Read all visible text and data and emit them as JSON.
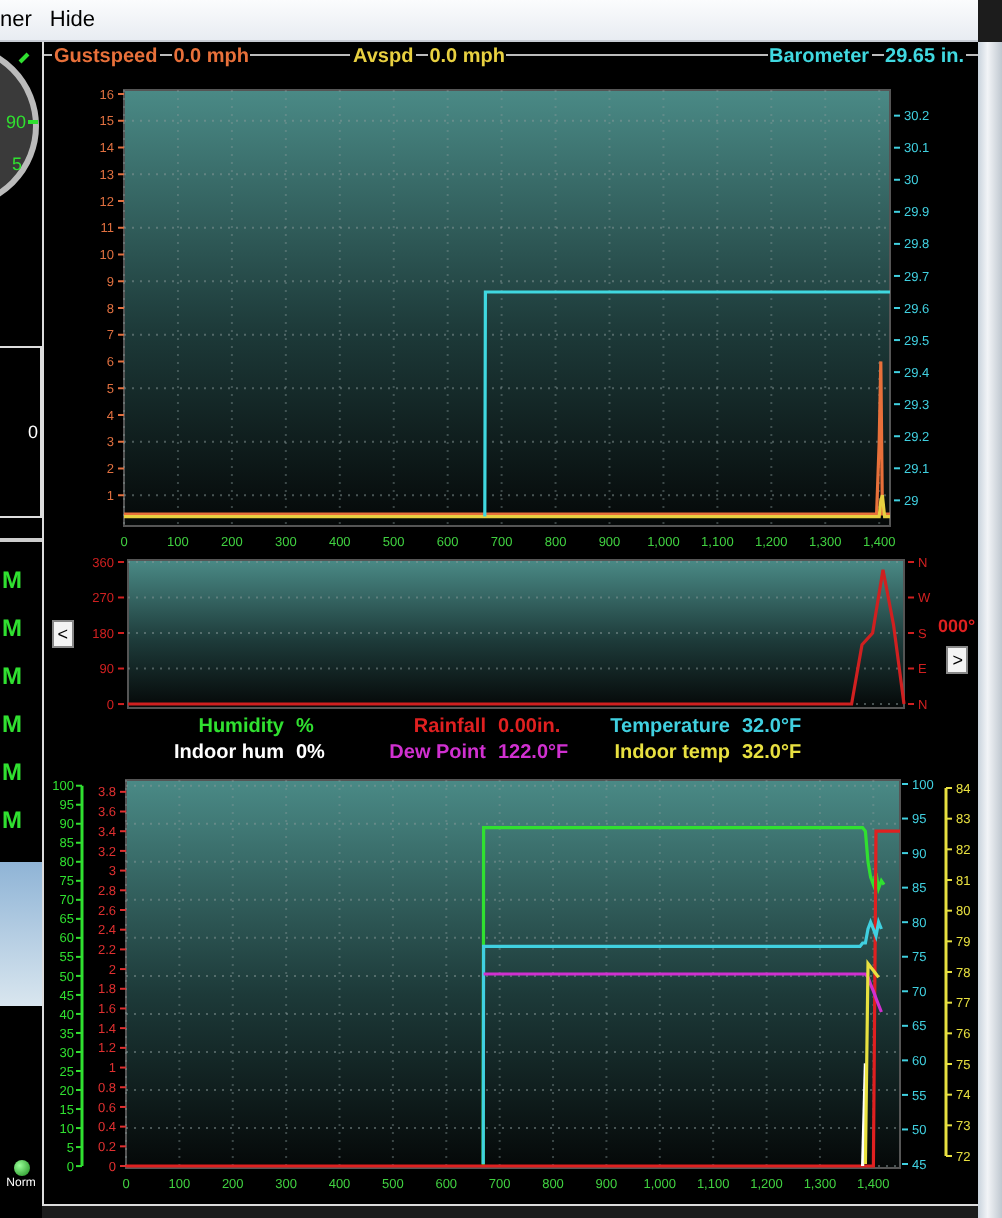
{
  "menu": [
    {
      "label": "ner"
    },
    {
      "label": "Hide"
    }
  ],
  "side_panel": {
    "gauge_labels": [
      "90",
      "5"
    ],
    "box_value": "0",
    "times": [
      "M",
      "M",
      "M",
      "M",
      "M",
      "M"
    ],
    "status": "Norm"
  },
  "speed_chart": {
    "readings": [
      "0.0 mph",
      "0.0 mph",
      "29.65 in."
    ],
    "chart_data": {
      "type": "line",
      "grid": true,
      "x": [
        0,
        669,
        670,
        1385,
        1390,
        1395,
        1400,
        1403,
        1406,
        1410,
        1420
      ],
      "xlim": [
        0,
        1420
      ],
      "ylim": [
        -0.15,
        16.15
      ],
      "xticks": [
        0,
        100,
        200,
        300,
        400,
        500,
        600,
        700,
        800,
        900,
        {
          "value": 1000,
          "label": "1,000"
        },
        {
          "value": 1100,
          "label": "1,100"
        },
        {
          "value": 1200,
          "label": "1,200"
        },
        {
          "value": 1300,
          "label": "1,300"
        },
        {
          "value": 1400,
          "label": "1,400"
        }
      ],
      "yticks": [
        1,
        2,
        3,
        4,
        5,
        6,
        7,
        8,
        9,
        10,
        11,
        12,
        13,
        14,
        15,
        16
      ],
      "y2lim": [
        28.92,
        30.28
      ],
      "y2ticks": [
        29,
        29.1,
        29.2,
        29.3,
        29.4,
        29.5,
        29.6,
        29.7,
        29.8,
        29.9,
        30,
        30.1,
        30.2
      ],
      "series": [
        {
          "name": "Gustspeed",
          "color": "#e8703a",
          "values": [
            0.3,
            0.3,
            0.3,
            0.3,
            0.3,
            0.3,
            3,
            6,
            0.3,
            0.3,
            0.3
          ]
        },
        {
          "name": "Avspd",
          "color": "#e8d040",
          "values": [
            0.2,
            0.2,
            0.2,
            0.2,
            0.2,
            0.2,
            0.2,
            0.8,
            1,
            0.2,
            0.2
          ]
        },
        {
          "name": "Barometer",
          "color": "#40d8e0",
          "axis": "y2",
          "values": [
            null,
            28.95,
            29.65,
            29.65,
            29.65,
            29.65,
            29.65,
            29.65,
            29.65,
            29.65,
            29.65
          ]
        }
      ]
    }
  },
  "direction_chart": {
    "reading": "000°",
    "prev_label": "<",
    "next_label": ">",
    "side_axis_labels": [
      "N",
      "W",
      "S",
      "E",
      "N"
    ],
    "chart_data": {
      "type": "line",
      "grid": true,
      "categories": [
        null,
        null,
        null,
        null,
        null,
        null,
        null,
        null,
        null,
        null,
        null,
        null,
        null,
        null,
        null,
        null,
        null,
        null,
        null,
        null,
        null,
        null,
        null,
        null,
        null,
        null,
        null,
        null,
        null,
        null,
        null,
        null,
        null,
        null,
        null,
        null,
        null,
        null,
        null,
        null,
        null,
        null,
        null,
        null,
        null,
        null,
        null,
        null,
        null,
        null,
        null,
        null,
        null,
        null,
        null,
        null,
        null,
        null,
        null,
        null,
        null,
        null,
        null,
        null,
        null,
        null,
        null,
        null,
        null,
        null,
        null,
        null,
        null,
        null,
        null
      ],
      "ylim": [
        -10,
        365
      ],
      "yticks": [
        0,
        90,
        180,
        270,
        360
      ],
      "series": [
        {
          "color": "#d02020",
          "values": [
            0,
            0,
            0,
            0,
            0,
            0,
            0,
            0,
            0,
            0,
            0,
            0,
            0,
            0,
            0,
            0,
            0,
            0,
            0,
            0,
            0,
            0,
            0,
            0,
            0,
            0,
            0,
            0,
            0,
            0,
            0,
            0,
            0,
            0,
            0,
            0,
            0,
            0,
            0,
            0,
            0,
            0,
            0,
            0,
            0,
            0,
            0,
            0,
            0,
            0,
            0,
            0,
            0,
            0,
            0,
            0,
            0,
            0,
            0,
            0,
            0,
            0,
            0,
            0,
            0,
            0,
            0,
            0,
            0,
            0,
            150,
            180,
            340,
            200,
            0
          ]
        }
      ]
    }
  },
  "climate_chart": {
    "readings": [
      "%",
      "0.00in.",
      "32.0°F",
      "0%",
      "122.0°F",
      "32.0°F"
    ],
    "side_axis_labels": [
      "84",
      "83",
      "82",
      "81",
      "80",
      "79",
      "78",
      "77",
      "76",
      "75",
      "74",
      "73",
      "72"
    ],
    "chart_data": {
      "type": "line",
      "grid": true,
      "x": [
        0,
        669,
        670,
        1375,
        1380,
        1385,
        1390,
        1395,
        1400,
        1405,
        1410,
        1415,
        1420,
        1425,
        1430,
        1450
      ],
      "xlim": [
        0,
        1450
      ],
      "ylim": [
        -0.5,
        101.5
      ],
      "xticks": [
        0,
        100,
        200,
        300,
        400,
        500,
        600,
        700,
        800,
        900,
        {
          "value": 1000,
          "label": "1,000"
        },
        {
          "value": 1100,
          "label": "1,100"
        },
        {
          "value": 1200,
          "label": "1,200"
        },
        {
          "value": 1300,
          "label": "1,300"
        },
        {
          "value": 1400,
          "label": "1,400"
        }
      ],
      "yticks": [
        0,
        5,
        10,
        15,
        20,
        25,
        30,
        35,
        40,
        45,
        50,
        55,
        60,
        65,
        70,
        75,
        80,
        85,
        90,
        95,
        100
      ],
      "y2lim": [
        44.42,
        100.58
      ],
      "y2ticks": [
        45,
        50,
        55,
        60,
        65,
        70,
        75,
        80,
        85,
        90,
        95,
        100
      ],
      "y3lim": [
        -0.02,
        3.92
      ],
      "y3ticks": [
        0,
        0.2,
        0.4,
        0.6,
        0.8,
        1,
        1.2,
        1.4,
        1.6,
        1.8,
        2,
        2.2,
        2.4,
        2.6,
        2.8,
        3,
        3.2,
        3.4,
        3.6,
        3.8
      ],
      "series": [
        {
          "name": "Humidity",
          "color": "#30e030",
          "values": [
            null,
            0,
            89,
            89,
            89,
            88,
            80,
            76,
            74,
            77,
            73,
            75,
            74,
            null,
            null,
            null
          ]
        },
        {
          "name": "Rainfall",
          "color": "#e02020",
          "axis": "y3",
          "values": [
            0,
            0,
            0,
            0,
            0,
            0,
            0,
            0,
            0,
            3.4,
            3.4,
            3.4,
            3.4,
            3.4,
            3.4,
            3.4
          ]
        },
        {
          "name": "Temperature",
          "color": "#40d0e0",
          "axis": "y2",
          "values": [
            null,
            45,
            76.5,
            76.5,
            77,
            77,
            79,
            80,
            79,
            78,
            80,
            79,
            null,
            null,
            null,
            null
          ]
        },
        {
          "name": "Indoor hum",
          "color": "#ffffff",
          "values": [
            null,
            null,
            null,
            null,
            0,
            27,
            null,
            null,
            null,
            null,
            null,
            null,
            null,
            null,
            null,
            null
          ]
        },
        {
          "name": "Dew Point",
          "color": "#d030d0",
          "axis": "y2",
          "values": [
            null,
            null,
            72.5,
            72.5,
            72.5,
            72.5,
            72,
            71,
            70,
            69,
            68,
            67,
            null,
            null,
            null,
            null
          ]
        },
        {
          "name": "Indoor temp",
          "color": "#e8e040",
          "axis": "y2",
          "values": [
            null,
            null,
            null,
            null,
            null,
            45,
            74,
            73.5,
            73,
            72.5,
            72,
            null,
            null,
            null,
            null,
            null
          ]
        }
      ]
    }
  }
}
